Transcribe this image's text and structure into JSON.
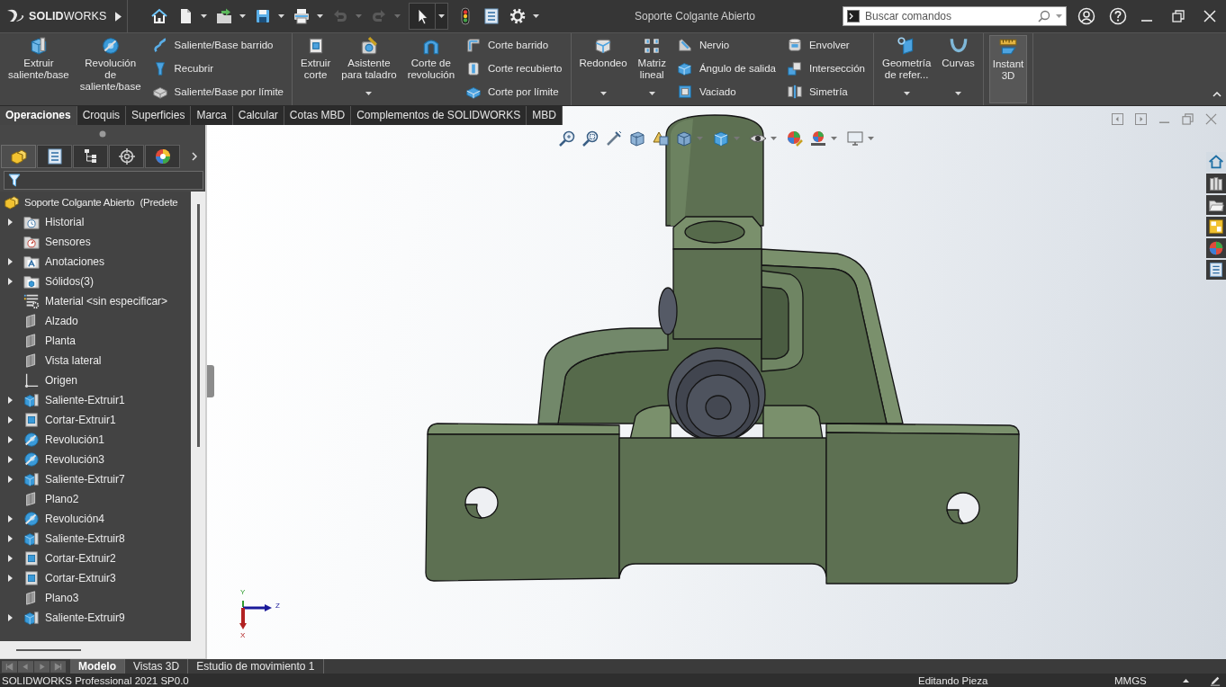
{
  "title_bar": {
    "logo": "**SOLID**WORKS",
    "document_title": "Soporte Colgante Abierto",
    "search": {
      "placeholder": "Buscar comandos"
    }
  },
  "quick_access": [
    {
      "kind": "home",
      "menu": false,
      "disabled": false,
      "selected": false
    },
    {
      "kind": "new",
      "menu": true,
      "disabled": false,
      "selected": false
    },
    {
      "kind": "open",
      "menu": true,
      "disabled": false,
      "selected": false
    },
    {
      "kind": "save",
      "menu": true,
      "disabled": false,
      "selected": false
    },
    {
      "kind": "print",
      "menu": true,
      "disabled": false,
      "selected": false
    },
    {
      "kind": "undo",
      "menu": true,
      "disabled": true,
      "selected": false
    },
    {
      "kind": "redo",
      "menu": true,
      "disabled": true,
      "selected": false
    },
    {
      "kind": "select",
      "menu": true,
      "disabled": false,
      "selected": true
    },
    {
      "kind": "rebuild",
      "menu": false,
      "disabled": false,
      "selected": false
    },
    {
      "kind": "properties",
      "menu": false,
      "disabled": false,
      "selected": false
    },
    {
      "kind": "options",
      "menu": true,
      "disabled": false,
      "selected": false
    }
  ],
  "ribbon": {
    "groups": [
      {
        "columns": [
          {
            "kind": "large",
            "buttons": [
              {
                "label": "Extruir\nsaliente/base",
                "menu": false,
                "on": false
              }
            ]
          },
          {
            "kind": "large",
            "buttons": [
              {
                "label": "Revolución\nde\nsaliente/base",
                "menu": false,
                "on": false
              }
            ]
          },
          {
            "kind": "stack",
            "buttons": [
              {
                "label": "Saliente/Base barrido",
                "on": false
              },
              {
                "label": "Recubrir",
                "on": false
              },
              {
                "label": "Saliente/Base por límite",
                "on": false
              }
            ]
          }
        ]
      },
      {
        "columns": [
          {
            "kind": "large",
            "buttons": [
              {
                "label": "Extruir\ncorte",
                "menu": false,
                "on": false
              }
            ]
          },
          {
            "kind": "large",
            "buttons": [
              {
                "label": "Asistente\npara taladro",
                "menu": true,
                "on": false
              }
            ]
          },
          {
            "kind": "large",
            "buttons": [
              {
                "label": "Corte de\nrevolución",
                "menu": false,
                "on": false
              }
            ]
          },
          {
            "kind": "stack",
            "buttons": [
              {
                "label": "Corte barrido",
                "on": false
              },
              {
                "label": "Corte recubierto",
                "on": false
              },
              {
                "label": "Corte por límite",
                "on": false
              }
            ]
          }
        ]
      },
      {
        "columns": [
          {
            "kind": "large",
            "buttons": [
              {
                "label": "Redondeo",
                "menu": true,
                "on": false
              }
            ]
          },
          {
            "kind": "large",
            "buttons": [
              {
                "label": "Matriz\nlineal",
                "menu": true,
                "on": false
              }
            ]
          },
          {
            "kind": "stack",
            "buttons": [
              {
                "label": "Nervio",
                "on": false
              },
              {
                "label": "Ángulo de salida",
                "on": false
              },
              {
                "label": "Vaciado",
                "on": false
              }
            ]
          },
          {
            "kind": "stack",
            "buttons": [
              {
                "label": "Envolver",
                "on": false
              },
              {
                "label": "Intersección",
                "on": false
              },
              {
                "label": "Simetría",
                "on": false
              }
            ]
          }
        ]
      },
      {
        "columns": [
          {
            "kind": "large",
            "buttons": [
              {
                "label": "Geometría\nde refer...",
                "menu": true,
                "on": false
              }
            ]
          },
          {
            "kind": "large",
            "buttons": [
              {
                "label": "Curvas",
                "menu": true,
                "on": false
              }
            ]
          }
        ]
      },
      {
        "columns": [
          {
            "kind": "large",
            "buttons": [
              {
                "label": "Instant\n3D",
                "menu": false,
                "on": true
              }
            ]
          }
        ]
      }
    ]
  },
  "command_tabs": [
    {
      "label": "Operaciones",
      "selected": true
    },
    {
      "label": "Croquis",
      "selected": false
    },
    {
      "label": "Superficies",
      "selected": false
    },
    {
      "label": "Marca",
      "selected": false
    },
    {
      "label": "Calcular",
      "selected": false
    },
    {
      "label": "Cotas MBD",
      "selected": false
    },
    {
      "label": "Complementos de SOLIDWORKS",
      "selected": false
    },
    {
      "label": "MBD",
      "selected": false
    }
  ],
  "feature_manager": {
    "tabs": [
      {
        "selected": true
      },
      {
        "selected": false
      },
      {
        "selected": false
      },
      {
        "selected": false
      },
      {
        "selected": false
      }
    ],
    "tree": {
      "label": "Soporte Colgante Abierto  (Predete",
      "kind": "part",
      "children": [
        {
          "label": "Historial",
          "kind": "history",
          "expandable": true
        },
        {
          "label": "Sensores",
          "kind": "sensors",
          "expandable": false
        },
        {
          "label": "Anotaciones",
          "kind": "annotations",
          "expandable": true
        },
        {
          "label": "Sólidos(3)",
          "kind": "bodies",
          "expandable": true
        },
        {
          "label": "Material <sin especificar>",
          "kind": "material",
          "expandable": false
        },
        {
          "label": "Alzado",
          "kind": "plane",
          "expandable": false
        },
        {
          "label": "Planta",
          "kind": "plane",
          "expandable": false
        },
        {
          "label": "Vista lateral",
          "kind": "plane",
          "expandable": false
        },
        {
          "label": "Origen",
          "kind": "origin",
          "expandable": false
        },
        {
          "label": "Saliente-Extruir1",
          "kind": "boss",
          "expandable": true
        },
        {
          "label": "Cortar-Extruir1",
          "kind": "cut",
          "expandable": true
        },
        {
          "label": "Revolución1",
          "kind": "revolve",
          "expandable": true
        },
        {
          "label": "Revolución3",
          "kind": "revolve",
          "expandable": true
        },
        {
          "label": "Saliente-Extruir7",
          "kind": "boss",
          "expandable": true
        },
        {
          "label": "Plano2",
          "kind": "plane",
          "expandable": false
        },
        {
          "label": "Revolución4",
          "kind": "revolve",
          "expandable": true
        },
        {
          "label": "Saliente-Extruir8",
          "kind": "boss",
          "expandable": true
        },
        {
          "label": "Cortar-Extruir2",
          "kind": "cut",
          "expandable": true
        },
        {
          "label": "Cortar-Extruir3",
          "kind": "cut",
          "expandable": true
        },
        {
          "label": "Plano3",
          "kind": "plane",
          "expandable": false
        },
        {
          "label": "Saliente-Extruir9",
          "kind": "boss",
          "expandable": true
        }
      ]
    }
  },
  "view_toolbar": [
    {
      "menu": false
    },
    {
      "menu": false
    },
    {
      "menu": false
    },
    {
      "menu": false
    },
    {
      "menu": false
    },
    {
      "menu": true
    },
    {
      "menu": true
    },
    {
      "menu": true
    },
    {
      "menu": false
    },
    {
      "menu": true
    },
    {
      "menu": true
    }
  ],
  "task_pane": [
    {
      "selected": true
    },
    {
      "selected": false
    },
    {
      "selected": false
    },
    {
      "selected": false
    },
    {
      "selected": false
    },
    {
      "selected": false
    }
  ],
  "triad_labels": [
    "Y",
    "Z",
    "X"
  ],
  "bottom_tabs": [
    {
      "label": "Modelo",
      "selected": true
    },
    {
      "label": "Vistas 3D",
      "selected": false
    },
    {
      "label": "Estudio de movimiento 1",
      "selected": false
    }
  ],
  "status_bar": {
    "product": "SOLIDWORKS Professional 2021 SP0.0",
    "mode": "Editando Pieza",
    "units": "MMGS"
  }
}
